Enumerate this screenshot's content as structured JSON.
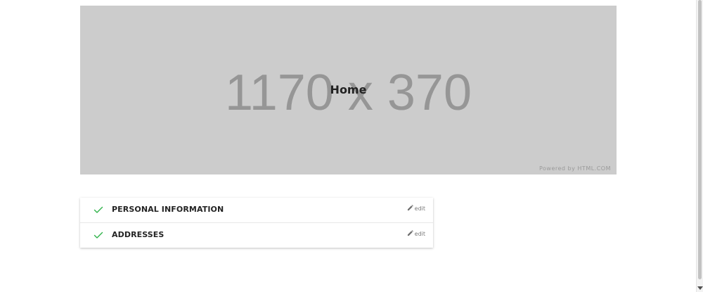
{
  "banner": {
    "placeholder_text": "1170 x 370",
    "title": "Home",
    "powered_by": "Powered by HTML.COM",
    "background_color": "#cccccc"
  },
  "checkout_steps": [
    {
      "title": "PERSONAL INFORMATION",
      "status_icon": "check-icon",
      "edit_label": "edit",
      "edit_icon": "pencil-icon"
    },
    {
      "title": "ADDRESSES",
      "status_icon": "check-icon",
      "edit_label": "edit",
      "edit_icon": "pencil-icon"
    }
  ],
  "colors": {
    "check": "#2fb34a",
    "title_text": "#232323",
    "edit_text": "#7a7a7a"
  }
}
